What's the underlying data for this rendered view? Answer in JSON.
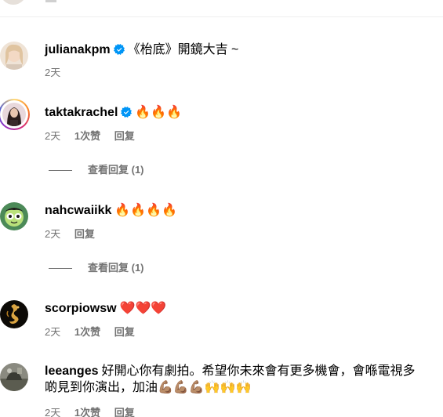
{
  "comments": [
    {
      "username": "julianakpm",
      "verified": true,
      "text": "《枱底》開鏡大吉 ~",
      "time": "2天",
      "likes": "",
      "reply": "",
      "view_replies": ""
    },
    {
      "username": "taktakrachel",
      "verified": true,
      "text": "🔥🔥🔥",
      "time": "2天",
      "likes": "1次赞",
      "reply": "回复",
      "view_replies": "查看回复 (1)"
    },
    {
      "username": "nahcwaiikk",
      "verified": false,
      "text": "🔥🔥🔥🔥",
      "time": "2天",
      "likes": "",
      "reply": "回复",
      "view_replies": "查看回复 (1)"
    },
    {
      "username": "scorpiowsw",
      "verified": false,
      "text": "❤️❤️❤️",
      "time": "2天",
      "likes": "1次赞",
      "reply": "回复",
      "view_replies": ""
    },
    {
      "username": "leeanges",
      "verified": false,
      "text": "好開心你有劇拍。希望你未來會有更多機會，會喺電視多啲見到你演出，加油💪🏽💪🏽💪🏽🙌🙌🙌",
      "time": "2天",
      "likes": "1次赞",
      "reply": "回复",
      "view_replies": ""
    }
  ],
  "colors": {
    "secondary_text": "#737373",
    "verified_blue": "#0095f6",
    "divider": "#efefef"
  },
  "icons": {
    "verified": "verified-badge-icon"
  }
}
